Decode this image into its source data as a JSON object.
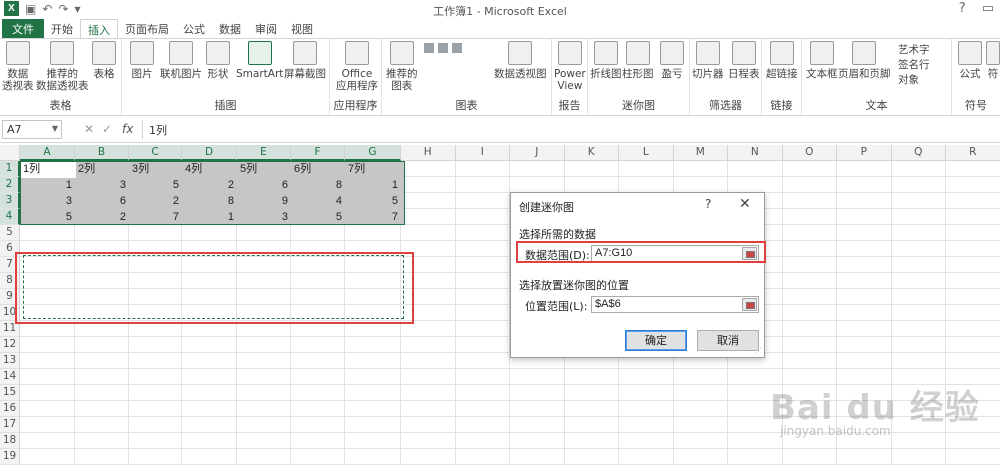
{
  "titlebar": {
    "title": "工作簿1 - Microsoft Excel",
    "logo": "X",
    "help": "?"
  },
  "tabs": [
    "文件",
    "开始",
    "插入",
    "页面布局",
    "公式",
    "数据",
    "审阅",
    "视图"
  ],
  "ribbon": {
    "groups": [
      {
        "label": "表格",
        "buttons": [
          "数据\n透视表",
          "推荐的\n数据透视表",
          "表格"
        ]
      },
      {
        "label": "插图",
        "buttons": [
          "图片",
          "联机图片",
          "形状",
          "SmartArt",
          "屏幕截图"
        ]
      },
      {
        "label": "应用程序",
        "buttons": [
          "Office\n应用程序"
        ]
      },
      {
        "label": "图表",
        "buttons": [
          "推荐的\n图表",
          "数据透视图"
        ]
      },
      {
        "label": "报告",
        "buttons": [
          "Power\nView"
        ]
      },
      {
        "label": "迷你图",
        "buttons": [
          "折线图",
          "柱形图",
          "盈亏"
        ]
      },
      {
        "label": "筛选器",
        "buttons": [
          "切片器",
          "日程表"
        ]
      },
      {
        "label": "链接",
        "buttons": [
          "超链接"
        ]
      },
      {
        "label": "文本",
        "buttons": [
          "文本框",
          "页眉和页脚",
          "艺术字",
          "签名行",
          "对象"
        ]
      },
      {
        "label": "符号",
        "buttons": [
          "公式",
          "符"
        ]
      }
    ]
  },
  "formula_bar": {
    "name_box": "A7",
    "cancel": "✕",
    "enter": "✓",
    "fx": "fx",
    "value": "1列"
  },
  "columns": [
    "A",
    "B",
    "C",
    "D",
    "E",
    "F",
    "G",
    "H",
    "I",
    "J",
    "K",
    "L",
    "M",
    "N",
    "O",
    "P",
    "Q",
    "R"
  ],
  "rows": [
    "1",
    "2",
    "3",
    "4",
    "5",
    "6",
    "7",
    "8",
    "9",
    "10",
    "11",
    "12",
    "13",
    "14",
    "15",
    "16",
    "17",
    "18",
    "19"
  ],
  "cells": {
    "header": [
      "1列",
      "2列",
      "3列",
      "4列",
      "5列",
      "6列",
      "7列"
    ],
    "data": [
      [
        "1",
        "3",
        "5",
        "2",
        "6",
        "8",
        "1"
      ],
      [
        "3",
        "6",
        "2",
        "8",
        "9",
        "4",
        "5"
      ],
      [
        "5",
        "2",
        "7",
        "1",
        "3",
        "5",
        "7"
      ]
    ]
  },
  "dialog": {
    "title": "创建迷你图",
    "help": "?",
    "close": "✕",
    "section1": "选择所需的数据",
    "data_range_label": "数据范围(D):",
    "data_range_value": "A7:G10",
    "section2": "选择放置迷你图的位置",
    "location_label": "位置范围(L):",
    "location_value": "$A$6",
    "ok": "确定",
    "cancel": "取消"
  },
  "watermark": {
    "brand": "Bai du 经验",
    "url": "jingyan.baidu.com"
  }
}
